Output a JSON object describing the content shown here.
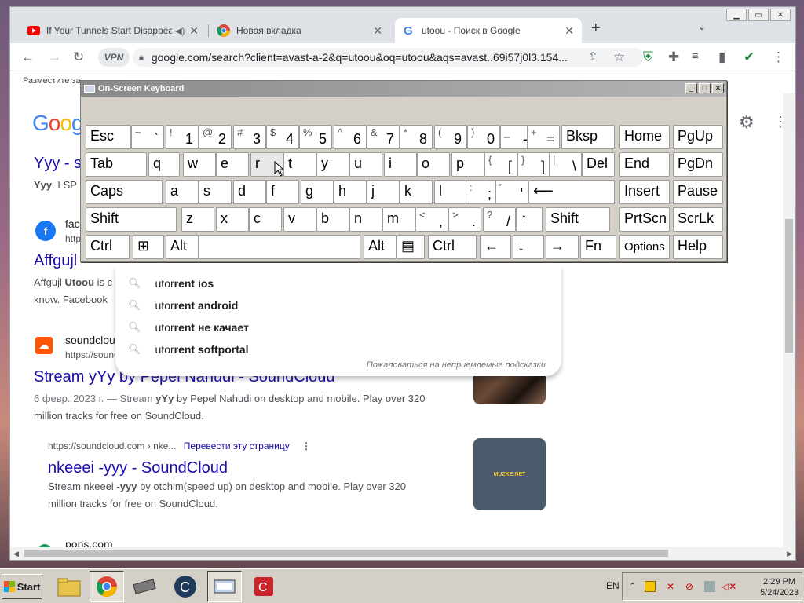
{
  "browser": {
    "tabs": [
      {
        "title": "If Your Tunnels Start Disappear",
        "icon": "youtube-icon"
      },
      {
        "title": "Новая вкладка",
        "icon": "chrome-icon"
      },
      {
        "title": "utoou - Поиск в Google",
        "icon": "google-icon"
      }
    ],
    "address": "google.com/search?client=avast-a-2&q=utoou&oq=utoou&aqs=avast..69i57j0l3.154...",
    "vpn_label": "VPN",
    "bookmarks_bar_text": "Разместите за"
  },
  "results": [
    {
      "title": "Yyy - s",
      "snippet_bold": "Yyy",
      "snippet_rest": ". LSP"
    },
    {
      "site": "fac",
      "url": "http",
      "title": "Affgujl",
      "snippet1_pre": "Affgujl ",
      "snippet1_bold": "Utoou",
      "snippet1_post": " is c",
      "snippet2": "know. Facebook"
    },
    {
      "site": "soundcloud",
      "url": "https://sound",
      "title": "Stream yYy by Pepel Nahudi - SoundCloud",
      "date": "6 февр. 2023 г. — Stream ",
      "bold": "yYy",
      "snippet_a": " by Pepel Nahudi on desktop and mobile. Play over 320",
      "snippet_b": "million tracks for free on SoundCloud."
    },
    {
      "url": "https://soundcloud.com › nke...",
      "translate": "Перевести эту страницу",
      "title": "nkeeei -yyy - SoundCloud",
      "snippet_pre": "Stream nkeeei ",
      "bold": "-yyy",
      "snippet_post": " by otchim(speed up) on desktop and mobile. Play over 320",
      "snippet_b": "million tracks for free on SoundCloud.",
      "thumb_text": "MUZKE.NET"
    },
    {
      "site": "pons.com"
    }
  ],
  "suggestions": [
    {
      "prefix": "utor",
      "bold": "rent ios"
    },
    {
      "prefix": "utor",
      "bold": "rent android"
    },
    {
      "prefix": "utor",
      "bold": "rent не качает"
    },
    {
      "prefix": "utor",
      "bold": "rent softportal"
    }
  ],
  "suggest_report": "Пожаловаться на неприемлемые подсказки",
  "osk": {
    "title": "On-Screen Keyboard",
    "rows": [
      [
        {
          "l": "Esc"
        },
        {
          "sh": "~",
          "un": "`"
        },
        {
          "sh": "!",
          "un": "1"
        },
        {
          "sh": "@",
          "un": "2"
        },
        {
          "sh": "#",
          "un": "3"
        },
        {
          "sh": "$",
          "un": "4"
        },
        {
          "sh": "%",
          "un": "5"
        },
        {
          "sh": "^",
          "un": "6"
        },
        {
          "sh": "&",
          "un": "7"
        },
        {
          "sh": "*",
          "un": "8"
        },
        {
          "sh": "(",
          "un": "9"
        },
        {
          "sh": ")",
          "un": "0"
        },
        {
          "sh": "_",
          "un": "-"
        },
        {
          "sh": "+",
          "un": "="
        },
        {
          "l": "Bksp"
        },
        {
          "l": "Home"
        },
        {
          "l": "PgUp"
        }
      ],
      [
        {
          "l": "Tab"
        },
        {
          "l": "q"
        },
        {
          "l": "w"
        },
        {
          "l": "e"
        },
        {
          "l": "r"
        },
        {
          "l": "t"
        },
        {
          "l": "y"
        },
        {
          "l": "u"
        },
        {
          "l": "i"
        },
        {
          "l": "o"
        },
        {
          "l": "p"
        },
        {
          "sh": "{",
          "un": "["
        },
        {
          "sh": "}",
          "un": "]"
        },
        {
          "sh": "|",
          "un": "\\"
        },
        {
          "l": "Del"
        },
        {
          "l": "End"
        },
        {
          "l": "PgDn"
        }
      ],
      [
        {
          "l": "Caps"
        },
        {
          "l": "a"
        },
        {
          "l": "s"
        },
        {
          "l": "d"
        },
        {
          "l": "f"
        },
        {
          "l": "g"
        },
        {
          "l": "h"
        },
        {
          "l": "j"
        },
        {
          "l": "k"
        },
        {
          "l": "l"
        },
        {
          "sh": ":",
          "un": ";"
        },
        {
          "sh": "\"",
          "un": "'"
        },
        {
          "l": "⟵"
        },
        {
          "l": "Insert"
        },
        {
          "l": "Pause"
        }
      ],
      [
        {
          "l": "Shift"
        },
        {
          "l": "z"
        },
        {
          "l": "x"
        },
        {
          "l": "c"
        },
        {
          "l": "v"
        },
        {
          "l": "b"
        },
        {
          "l": "n"
        },
        {
          "l": "m"
        },
        {
          "sh": "<",
          "un": ","
        },
        {
          "sh": ">",
          "un": "."
        },
        {
          "sh": "?",
          "un": "/"
        },
        {
          "l": "↑"
        },
        {
          "l": "Shift"
        },
        {
          "l": "PrtScn"
        },
        {
          "l": "ScrLk"
        }
      ],
      [
        {
          "l": "Ctrl"
        },
        {
          "l": "⊞"
        },
        {
          "l": "Alt"
        },
        {
          "l": ""
        },
        {
          "l": "Alt"
        },
        {
          "l": "▤"
        },
        {
          "l": "Ctrl"
        },
        {
          "l": "←"
        },
        {
          "l": "↓"
        },
        {
          "l": "→"
        },
        {
          "l": "Fn"
        },
        {
          "l": "Options"
        },
        {
          "l": "Help"
        }
      ]
    ]
  },
  "taskbar": {
    "start_label": "Start",
    "lang": "EN",
    "time": "2:29 PM",
    "date": "5/24/2023"
  }
}
